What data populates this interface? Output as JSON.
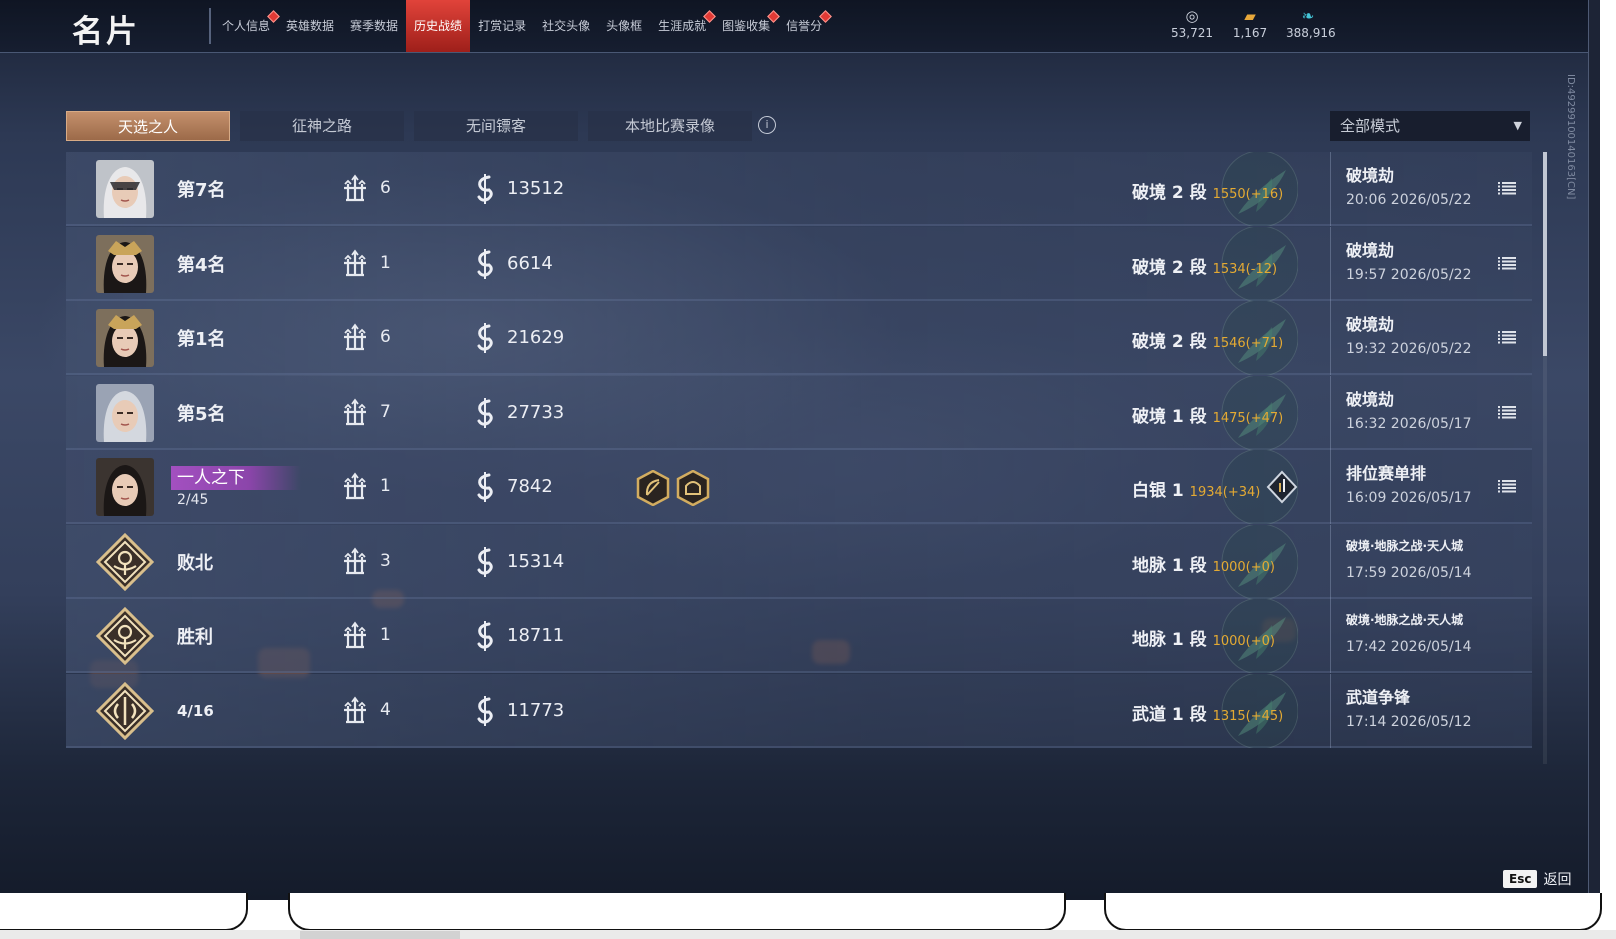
{
  "app": {
    "title": "名片",
    "id_label": "ID:4929910014016​3[CN]"
  },
  "nav": {
    "tabs": [
      {
        "label": "个人信息",
        "active": false,
        "badge": true
      },
      {
        "label": "英雄数据",
        "active": false,
        "badge": false
      },
      {
        "label": "赛季数据",
        "active": false,
        "badge": false
      },
      {
        "label": "历史战绩",
        "active": true,
        "badge": false
      },
      {
        "label": "打赏记录",
        "active": false,
        "badge": false
      },
      {
        "label": "社交头像",
        "active": false,
        "badge": false
      },
      {
        "label": "头像框",
        "active": false,
        "badge": false
      },
      {
        "label": "生涯成就",
        "active": false,
        "badge": true
      },
      {
        "label": "图鉴收集",
        "active": false,
        "badge": true
      },
      {
        "label": "信誉分",
        "active": false,
        "badge": true
      }
    ]
  },
  "currencies": [
    {
      "icon": "coin-stack-icon",
      "value": "53,721"
    },
    {
      "icon": "gold-ingot-icon",
      "value": "1,167"
    },
    {
      "icon": "jade-feather-icon",
      "value": "388,916"
    }
  ],
  "subtabs": [
    {
      "label": "天选之人",
      "active": true
    },
    {
      "label": "征神之路",
      "active": false
    },
    {
      "label": "无间镖客",
      "active": false
    },
    {
      "label": "本地比赛录像",
      "active": false
    }
  ],
  "mode_filter": {
    "selected": "全部模式"
  },
  "records": [
    {
      "avatar": "portrait-veiled-woman",
      "place": "第7名",
      "name_highlight": "",
      "fraction": "",
      "kills": "6",
      "gold": "13512",
      "medals": [],
      "tier": "破境 2 段",
      "score": "1550(+16)",
      "mode": "破境劫",
      "time": "20:06  2026/05/22",
      "mode_small": false
    },
    {
      "avatar": "portrait-crowned-warrior",
      "place": "第4名",
      "name_highlight": "",
      "fraction": "",
      "kills": "1",
      "gold": "6614",
      "medals": [],
      "tier": "破境 2 段",
      "score": "1534(-12)",
      "mode": "破境劫",
      "time": "19:57  2026/05/22",
      "mode_small": false
    },
    {
      "avatar": "portrait-crowned-warrior",
      "place": "第1名",
      "name_highlight": "",
      "fraction": "",
      "kills": "6",
      "gold": "21629",
      "medals": [],
      "tier": "破境 2 段",
      "score": "1546(+71)",
      "mode": "破境劫",
      "time": "19:32  2026/05/22",
      "mode_small": false
    },
    {
      "avatar": "portrait-silver-hair",
      "place": "第5名",
      "name_highlight": "",
      "fraction": "",
      "kills": "7",
      "gold": "27733",
      "medals": [],
      "tier": "破境 1 段",
      "score": "1475(+47)",
      "mode": "破境劫",
      "time": "16:32  2026/05/17",
      "mode_small": false
    },
    {
      "avatar": "portrait-black-hair",
      "place": "",
      "name_highlight": "一人之下",
      "fraction": "2/45",
      "kills": "1",
      "gold": "7842",
      "medals": [
        "medal-bow-icon",
        "medal-helmet-icon"
      ],
      "tier": "白银 1",
      "score": "1934(+34)",
      "mode": "排位赛单排",
      "time": "16:09  2026/05/17",
      "mode_small": false
    },
    {
      "avatar": "emblem-defeat",
      "place": "败北",
      "name_highlight": "",
      "fraction": "",
      "kills": "3",
      "gold": "15314",
      "medals": [],
      "tier": "地脉 1 段",
      "score": "1000(+0)",
      "mode": "破境·地脉之战·天人城",
      "time": "17:59  2026/05/14",
      "mode_small": true
    },
    {
      "avatar": "emblem-victory",
      "place": "胜利",
      "name_highlight": "",
      "fraction": "",
      "kills": "1",
      "gold": "18711",
      "medals": [],
      "tier": "地脉 1 段",
      "score": "1000(+0)",
      "mode": "破境·地脉之战·天人城",
      "time": "17:42  2026/05/14",
      "mode_small": true
    },
    {
      "avatar": "emblem-martial",
      "place": "4/16",
      "name_highlight": "",
      "fraction": "",
      "kills": "4",
      "gold": "11773",
      "medals": [],
      "tier": "武道 1 段",
      "score": "1315(+45)",
      "mode": "武道争锋",
      "time": "17:14  2026/05/12",
      "mode_small": false
    }
  ],
  "footer": {
    "esc_key": "Esc",
    "esc_label": "返回"
  },
  "colors": {
    "accent_red": "#d93b33",
    "score_gold": "#e4aa33",
    "active_subtab": "#b07d59",
    "name_highlight": "#9b4cbb"
  }
}
